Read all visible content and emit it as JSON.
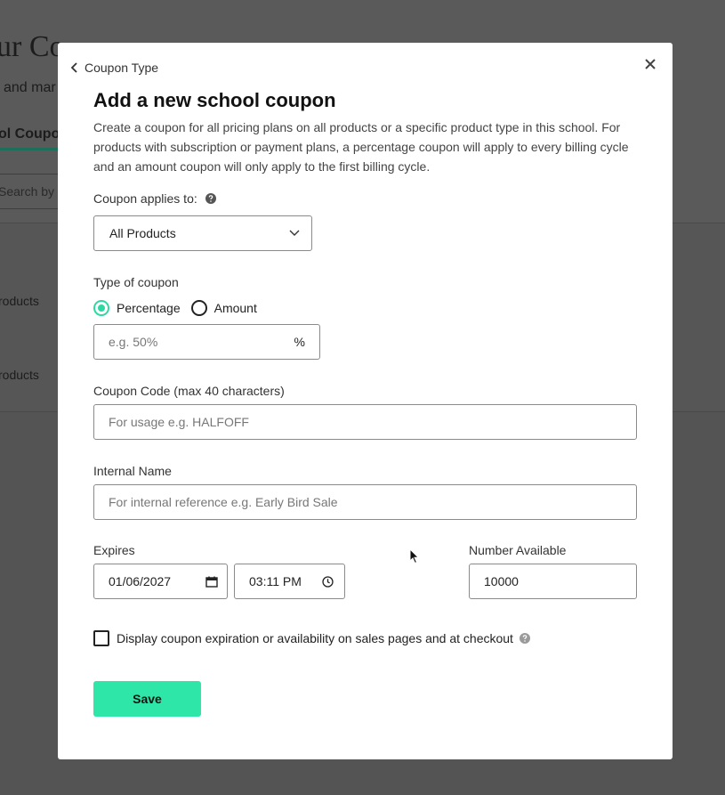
{
  "background": {
    "title": "ur Co",
    "subtitle": "and mar",
    "tab": "ol Coupo",
    "search_placeholder": "Search by",
    "row1": "roducts",
    "row2": "roducts"
  },
  "modal": {
    "back_label": "Coupon Type",
    "title": "Add a new school coupon",
    "description": "Create a coupon for all pricing plans on all products or a specific product type in this school. For products with subscription or payment plans, a percentage coupon will apply to every billing cycle and an amount coupon will only apply to the first billing cycle.",
    "applies_to": {
      "label": "Coupon applies to:",
      "selected": "All Products"
    },
    "type": {
      "label": "Type of coupon",
      "options": [
        {
          "label": "Percentage",
          "checked": true
        },
        {
          "label": "Amount",
          "checked": false
        }
      ],
      "value_placeholder": "e.g. 50%",
      "suffix": "%"
    },
    "code": {
      "label": "Coupon Code (max 40 characters)",
      "placeholder": "For usage e.g. HALFOFF"
    },
    "internal_name": {
      "label": "Internal Name",
      "placeholder": "For internal reference e.g. Early Bird Sale"
    },
    "expires": {
      "label": "Expires",
      "date": "01/06/2027",
      "time": "03:11 PM"
    },
    "number_available": {
      "label": "Number Available",
      "value": "10000"
    },
    "display_checkbox": {
      "label": "Display coupon expiration or availability on sales pages and at checkout",
      "checked": false
    },
    "save_label": "Save"
  },
  "colors": {
    "accent": "#2ee6a8",
    "radio_checked": "#2ed8a3",
    "overlay": "#545454"
  },
  "icons": [
    "chevron-left-icon",
    "close-icon",
    "help-icon",
    "chevron-down-icon",
    "calendar-icon",
    "clock-icon"
  ]
}
